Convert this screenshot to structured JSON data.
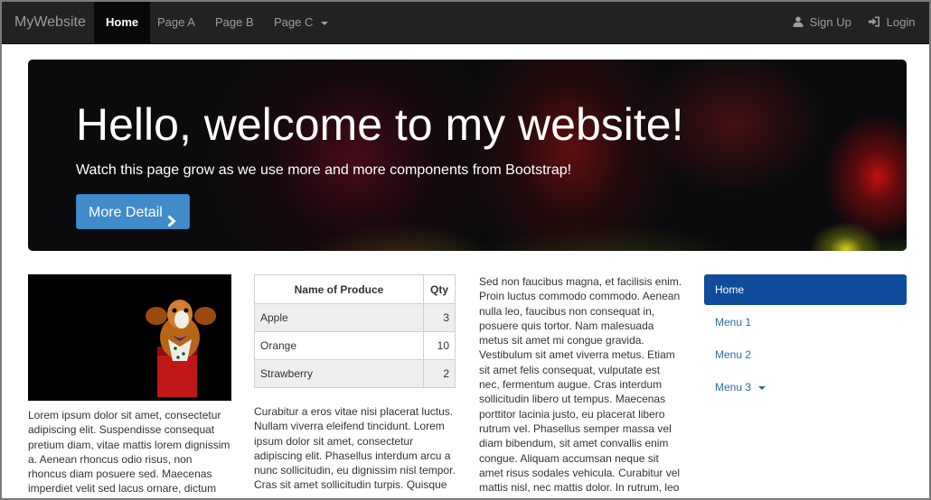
{
  "navbar": {
    "brand": "MyWebsite",
    "items": [
      {
        "label": "Home",
        "active": true
      },
      {
        "label": "Page A"
      },
      {
        "label": "Page B"
      },
      {
        "label": "Page C",
        "dropdown": true
      }
    ],
    "right": [
      {
        "label": "Sign Up",
        "icon": "user-icon"
      },
      {
        "label": "Login",
        "icon": "login-icon"
      }
    ]
  },
  "jumbotron": {
    "title": "Hello, welcome to my website!",
    "subtitle": "Watch this page grow as we use more and more components from Bootstrap!",
    "button_label": "More Detail",
    "button_icon": "chevron-right-icon"
  },
  "column1": {
    "text": "Lorem ipsum dolor sit amet, consectetur adipiscing elit. Suspendisse consequat pretium diam, vitae mattis lorem dignissim a. Aenean rhoncus odio risus, non rhoncus diam posuere sed. Maecenas imperdiet velit sed lacus ornare, dictum"
  },
  "table": {
    "headers": [
      "Name of Produce",
      "Qty"
    ],
    "rows": [
      {
        "name": "Apple",
        "qty": "3"
      },
      {
        "name": "Orange",
        "qty": "10"
      },
      {
        "name": "Strawberry",
        "qty": "2"
      }
    ]
  },
  "column2": {
    "text": "Curabitur a eros vitae nisi placerat luctus. Nullam viverra eleifend tincidunt. Lorem ipsum dolor sit amet, consectetur adipiscing elit. Phasellus interdum arcu a nunc sollicitudin, eu dignissim nisl tempor. Cras sit amet sollicitudin turpis. Quisque"
  },
  "column3": {
    "text": "Sed non faucibus magna, et facilisis enim. Proin luctus commodo commodo. Aenean nulla leo, faucibus non consequat in, posuere quis tortor. Nam malesuada metus sit amet mi congue gravida. Vestibulum sit amet viverra metus. Etiam sit amet felis consequat, vulputate est nec, fermentum augue. Cras interdum sollicitudin libero ut tempus. Maecenas porttitor lacinia justo, eu placerat libero rutrum vel. Phasellus semper massa vel diam bibendum, sit amet convallis enim congue. Aliquam accumsan neque sit amet risus sodales vehicula. Curabitur vel mattis nisl, nec mattis dolor. In rutrum, leo"
  },
  "side_menu": {
    "items": [
      {
        "label": "Home",
        "active": true
      },
      {
        "label": "Menu 1"
      },
      {
        "label": "Menu 2"
      },
      {
        "label": "Menu 3",
        "dropdown": true
      }
    ]
  },
  "colors": {
    "navbar_bg": "#222222",
    "accent": "#428bca",
    "side_active": "#0f4c9c",
    "link": "#2a6aa6"
  }
}
